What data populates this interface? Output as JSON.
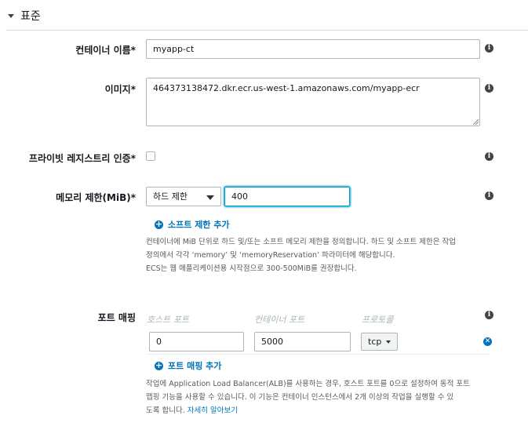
{
  "section": {
    "title": "표준"
  },
  "fields": {
    "container_name": {
      "label": "컨테이너 이름*",
      "value": "myapp-ct"
    },
    "image": {
      "label": "이미지*",
      "value": "464373138472.dkr.ecr.us-west-1.amazonaws.com/myapp-ecr"
    },
    "private_registry": {
      "label": "프라이빗 레지스트리 인증*"
    },
    "memory": {
      "label": "메모리 제한(MiB)*",
      "limit_type": "하드 제한",
      "value": "400",
      "add_soft_limit": "소프트 제한 추가",
      "help_lines": [
        "컨테이너에 MiB 단위로 하드 및/또는 소프트 메모리 제한을 정의합니다. 하드 및 소프트 제한은 작업",
        "정의에서 각각 ‘memory’ 및 ‘memoryReservation’ 파라미터에 해당합니다.",
        "ECS는 웹 애플리케이션용 시작점으로 300-500MiB를 권장합니다."
      ]
    },
    "port_mapping": {
      "label": "포트 매핑",
      "columns": [
        "호스트 포트",
        "컨테이너 포트",
        "프로토콜"
      ],
      "host_port": "0",
      "container_port": "5000",
      "protocol": "tcp",
      "add_label": "포트 매핑 추가",
      "help_lines": [
        "작업에 Application Load Balancer(ALB)를 사용하는 경우, 호스트 포트를 0으로 설정하여 동적 포트",
        "맵핑 기능을 사용할 수 있습니다. 이 기능은 컨테이너 인스턴스에서 2개 이상의 작업을 실행할 수 있",
        "도록 합니다."
      ],
      "help_link": "자세히 알아보기"
    }
  },
  "icons": {
    "info": "info-icon",
    "add": "plus-circle-icon",
    "remove": "remove-circle-icon",
    "collapse": "caret-down-icon"
  },
  "colors": {
    "accent": "#0073bb",
    "focus": "#00a1c9"
  }
}
